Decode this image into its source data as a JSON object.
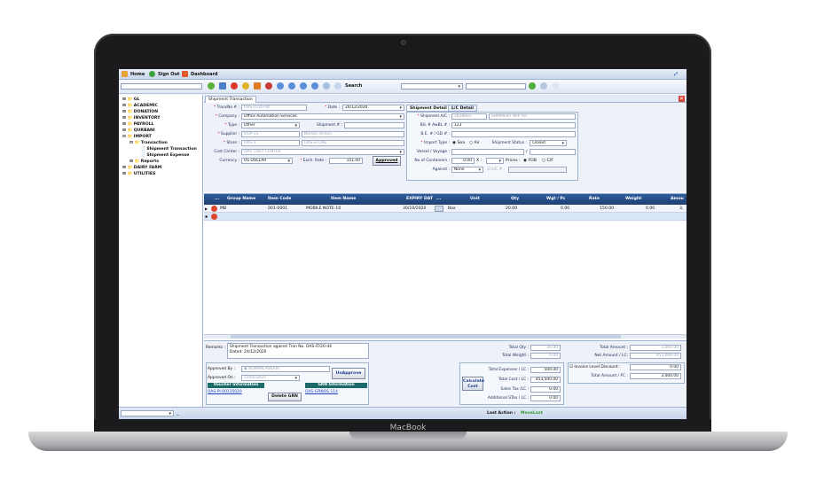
{
  "device": {
    "brand": "MacBook"
  },
  "topbar": {
    "home": "Home",
    "sign_out": "Sign Out",
    "dashboard": "Dashboard"
  },
  "toolbar": {
    "search_label": "Search"
  },
  "tree": {
    "items": [
      "GL",
      "ACADEMIC",
      "DONATION",
      "INVENTORY",
      "PAYROLL",
      "QURBANI",
      "IMPORT"
    ],
    "transaction": "Transaction",
    "shipment_transaction": "Shipment Transaction",
    "shipment_expense": "Shipment Expense",
    "reports": "Reports",
    "after": [
      "DAIRY FARM",
      "UTILITIES"
    ]
  },
  "tab": {
    "title": "Shipment Transaction"
  },
  "form": {
    "transno_label": "TransNo # :",
    "transno_value": "OAS-IT/20-44",
    "date_label": "Date :",
    "date_value": "24/12/2020",
    "company_label": "Company :",
    "company_value": "Office Automation Services",
    "type_label": "Type :",
    "type_value": "Other",
    "shipment_no_label": "Shipment # :",
    "supplier_label": "Supplier :",
    "supplier_code": "OUP-15",
    "supplier_name": "Noman Ansari",
    "store_label": "Store :",
    "store_code": "OAS-1",
    "store_name": "OAS-STORE",
    "cost_center_label": "Cost Center :",
    "cost_center_value": "OAS COST CENTER",
    "currency_label": "Currency :",
    "currency_value": "US DOLLAR",
    "exch_rate_label": "Exch. Rate :",
    "exch_rate_value": "151.00",
    "approved_button": "Approved"
  },
  "detail": {
    "tab1": "Shipment Detail",
    "tab2": "L/C Detail",
    "shipment_ac_label": "Shipment A/C :",
    "shipment_ac_code": "1828601",
    "shipment_ac_name": "SHIPMENT WIP A/C",
    "bl_label": "B/L # AwBL # :",
    "bl_value": "123",
    "be_label": "B.E. # / GD # :",
    "import_type_label": "Import Type :",
    "sea": "Sea",
    "air": "Air",
    "shipment_status_label": "Shipment Status :",
    "shipment_status_value": "Closed",
    "vessel_label": "Vessel / Voyage :",
    "vessel_sep": "/",
    "containers_label": "No of Containers :",
    "containers_value": "0.00",
    "x": "X :",
    "prices_label": "Prices :",
    "fob": "FOB",
    "cif": "C/F",
    "against_label": "Against :",
    "against_value": "None",
    "lc_label": "L/C # :"
  },
  "grid": {
    "headers": [
      "...",
      "Group Name",
      "Item Code",
      "Item Name",
      "EXPIRY DAT",
      "...",
      "Unit",
      "Qty",
      "Wgt / Pc",
      "Rate",
      "Weight",
      "Amou"
    ],
    "row": {
      "group": "MB",
      "item_code": "001-0001",
      "item_name": "MOBILE NOTE-10",
      "expiry": "30/10/2020",
      "unit": "Box",
      "qty": "20.00",
      "wgt": "0.00",
      "rate": "150.00",
      "weight": "0.00",
      "amount": "3,"
    }
  },
  "footer": {
    "remarks_label": "Remarks :",
    "remarks_line1": "Shipment Transaction against Tran No. OAS-IT/20-44",
    "remarks_line2": "Dated: 24/12/2020",
    "approved_by_label": "Approved By :",
    "approved_by_value": "NOMAN ANSARI",
    "approved_on_label": "Approved On :",
    "approved_on_value": "23/02/2021",
    "unapprove_button": "UnApprove",
    "voucher_header": "Voucher Information",
    "voucher_link": "OAS-PI-00135020",
    "grn_header": "GRN Information",
    "grn_link": "OAS-GRNOS-114",
    "delete_grn": "Delete GRN",
    "total_qty_label": "Total Qty :",
    "total_qty_value": "20.00",
    "total_weight_label": "Total Weight :",
    "total_weight_value": "0.00",
    "total_exp_label": "Total Expenses / LC :",
    "total_exp_value": "500.00",
    "calc_button_1": "Calculate",
    "calc_button_2": "Cost",
    "total_cost_label": "Total Cost / LC :",
    "total_cost_value": "453,500.00",
    "sales_tax_label": "Sales Tax /LC :",
    "sales_tax_value": "0.00",
    "add_stax_label": "Additional STax / LC :",
    "add_stax_value": "0.00",
    "total_amount_label": "Total Amount :",
    "total_amount_value": "3,000.00",
    "net_amount_label": "Net Amount / LC:",
    "net_amount_value": "453,000.00",
    "inv_disc_label": "Invoice Level Discount :",
    "inv_disc_value": "0.00",
    "total_amount_fc_label": "Total Amount / FC :",
    "total_amount_fc_value": "3,000.00"
  },
  "status": {
    "last_action_label": "Last Action :",
    "last_action_value": "MoveLast",
    "dash": "_"
  }
}
